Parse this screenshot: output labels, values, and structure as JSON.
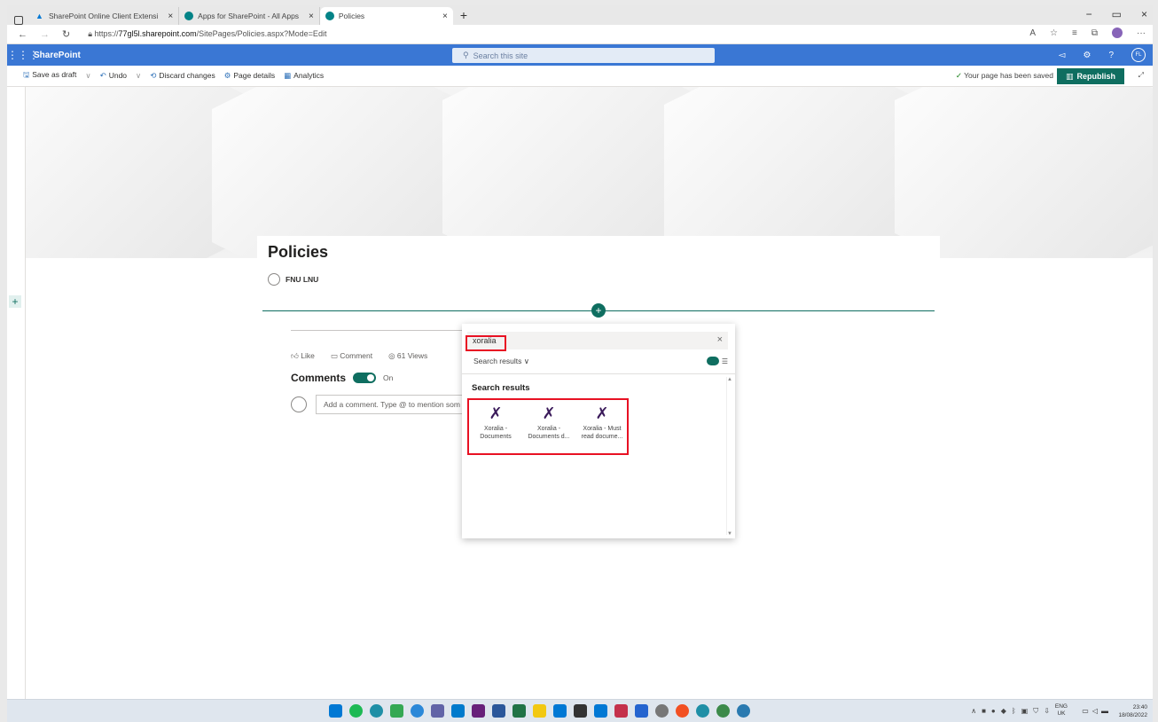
{
  "browser": {
    "tabs": [
      {
        "title": "SharePoint Online Client Extensi",
        "active": false
      },
      {
        "title": "Apps for SharePoint - All Apps",
        "active": false
      },
      {
        "title": "Policies",
        "active": true
      }
    ],
    "url_prefix": "https://",
    "url_domain": "77gl5l.sharepoint.com",
    "url_path": "/SitePages/Policies.aspx?Mode=Edit"
  },
  "suite": {
    "app_name": "SharePoint",
    "search_placeholder": "Search this site",
    "avatar_initials": "FL"
  },
  "command_bar": {
    "save_draft": "Save as draft",
    "undo": "Undo",
    "discard": "Discard changes",
    "page_details": "Page details",
    "analytics": "Analytics",
    "saved_status": "Your page has been saved",
    "republish": "Republish"
  },
  "page": {
    "title": "Policies",
    "author": "FNU LNU",
    "like": "Like",
    "comment": "Comment",
    "views": "61 Views",
    "comments_label": "Comments",
    "comments_toggle": "On",
    "add_comment_placeholder": "Add a comment. Type @ to mention som"
  },
  "picker": {
    "query": "xoralia",
    "filter_label": "Search results",
    "section_heading": "Search results",
    "results": [
      {
        "line1": "Xoralia -",
        "line2": "Documents"
      },
      {
        "line1": "Xoralia -",
        "line2": "Documents d..."
      },
      {
        "line1": "Xoralia - Must",
        "line2": "read docume..."
      }
    ]
  },
  "taskbar": {
    "lang_top": "ENG",
    "lang_bottom": "UK",
    "time": "23:40",
    "date": "18/08/2022"
  },
  "colors": {
    "suite_blue": "#3a77d4",
    "theme_teal": "#0f6e60",
    "highlight_red": "#e81123"
  }
}
